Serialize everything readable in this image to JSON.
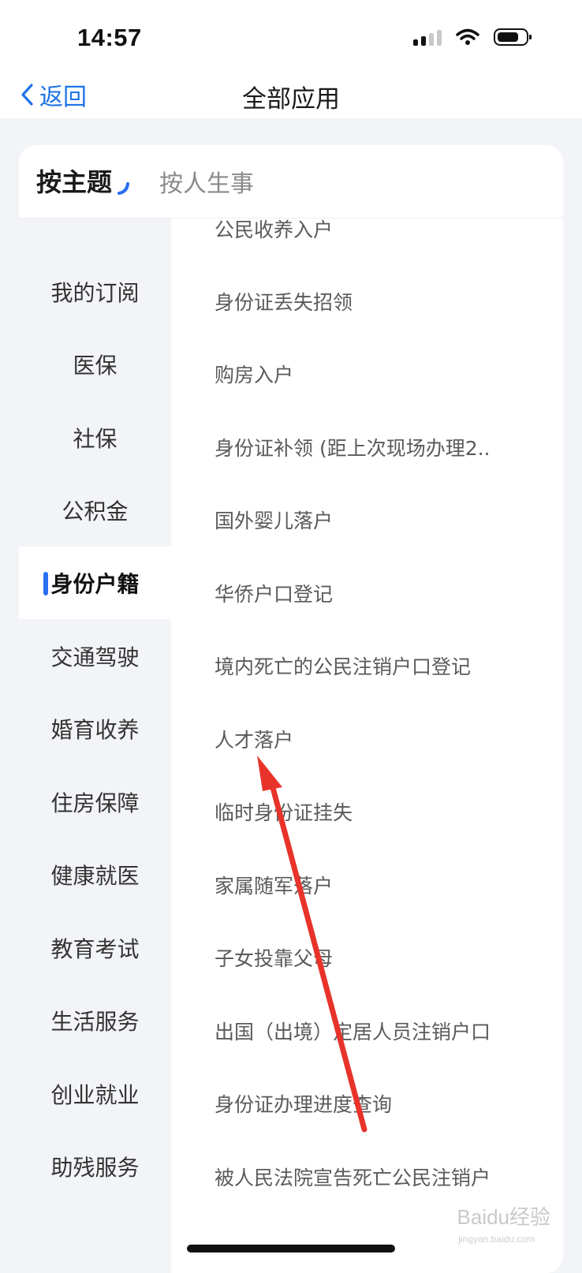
{
  "status_bar": {
    "time": "14:57",
    "icons": [
      "cellular-signal-icon",
      "wifi-icon",
      "battery-icon"
    ]
  },
  "nav": {
    "back_label": "返回",
    "title": "全部应用"
  },
  "tabs": {
    "active": "按主题",
    "inactive": "按人生事"
  },
  "sidebar": {
    "items": [
      {
        "label": "我的订阅"
      },
      {
        "label": "医保"
      },
      {
        "label": "社保"
      },
      {
        "label": "公积金"
      },
      {
        "label": "身份户籍",
        "active": true
      },
      {
        "label": "交通驾驶"
      },
      {
        "label": "婚育收养"
      },
      {
        "label": "住房保障"
      },
      {
        "label": "健康就医"
      },
      {
        "label": "教育考试"
      },
      {
        "label": "生活服务"
      },
      {
        "label": "创业就业"
      },
      {
        "label": "助残服务"
      }
    ]
  },
  "content": {
    "items": [
      {
        "label": "公民收养入户"
      },
      {
        "label": "身份证丢失招领"
      },
      {
        "label": "购房入户"
      },
      {
        "label": "身份证补领 (距上次现场办理2.."
      },
      {
        "label": "国外婴儿落户"
      },
      {
        "label": "华侨户口登记"
      },
      {
        "label": "境内死亡的公民注销户口登记"
      },
      {
        "label": "人才落户"
      },
      {
        "label": "临时身份证挂失"
      },
      {
        "label": "家属随军落户"
      },
      {
        "label": "子女投靠父母"
      },
      {
        "label": "出国（出境）定居人员注销户口"
      },
      {
        "label": "身份证办理进度查询"
      },
      {
        "label": "被人民法院宣告死亡公民注销户"
      }
    ]
  },
  "watermark": {
    "text": "Baidu经验",
    "sub": "jingyan.baidu.com"
  },
  "colors": {
    "accent": "#1f73e8",
    "indicator": "#2b6ef3",
    "annotation_arrow": "#e8332a"
  }
}
